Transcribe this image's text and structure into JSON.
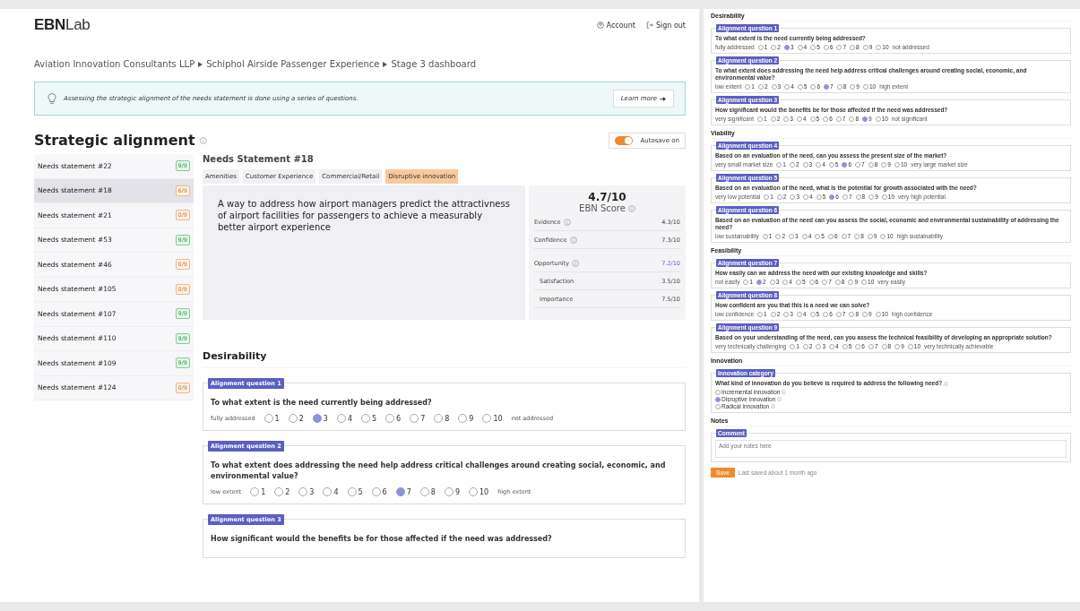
{
  "header": {
    "logo_bold": "EBN",
    "logo_light": "Lab",
    "links": [
      "Account",
      "Sign out"
    ]
  },
  "breadcrumb": [
    "Aviation Innovation Consultants LLP",
    "Schiphol Airside Passenger Experience",
    "Stage 3 dashboard"
  ],
  "banner": {
    "text": "Assessing the strategic alignment of the needs statement is done using a series of questions.",
    "link": "Learn more"
  },
  "page_title": "Strategic alignment",
  "autosave": {
    "label": "Autosave on",
    "on": true
  },
  "needs_list": [
    {
      "label": "Needs statement #22",
      "badge": "9/9",
      "complete": true,
      "selected": false
    },
    {
      "label": "Needs statement #18",
      "badge": "6/9",
      "complete": false,
      "selected": true
    },
    {
      "label": "Needs statement #21",
      "badge": "0/9",
      "complete": false,
      "selected": false
    },
    {
      "label": "Needs statement #53",
      "badge": "9/9",
      "complete": true,
      "selected": false
    },
    {
      "label": "Needs statement #46",
      "badge": "0/9",
      "complete": false,
      "selected": false
    },
    {
      "label": "Needs statement #105",
      "badge": "0/9",
      "complete": false,
      "selected": false
    },
    {
      "label": "Needs statement #107",
      "badge": "9/9",
      "complete": true,
      "selected": false
    },
    {
      "label": "Needs statement #110",
      "badge": "9/9",
      "complete": true,
      "selected": false
    },
    {
      "label": "Needs statement #109",
      "badge": "9/9",
      "complete": true,
      "selected": false
    },
    {
      "label": "Needs statement #124",
      "badge": "0/9",
      "complete": false,
      "selected": false
    }
  ],
  "statement": {
    "title": "Needs Statement #18",
    "tags": [
      {
        "label": "Amenities",
        "highlighted": false
      },
      {
        "label": "Customer Experience",
        "highlighted": false
      },
      {
        "label": "Commercial/Retail",
        "highlighted": false
      },
      {
        "label": "Disruptive innovation",
        "highlighted": true
      }
    ],
    "text": "A way to address how airport managers predict the attractivness of airport facilities for passengers to achieve a measurably better airport experience"
  },
  "score": {
    "value": "4.7/10",
    "label": "EBN Score",
    "rows": [
      {
        "kind": "metric",
        "label": "Evidence",
        "value": "4.3/10"
      },
      {
        "kind": "metric",
        "label": "Confidence",
        "value": "7.3/10"
      },
      {
        "kind": "highlight",
        "label": "Opportunity",
        "value": "7.2/10"
      },
      {
        "kind": "sub",
        "label": "Satisfaction",
        "value": "3.5/10"
      },
      {
        "kind": "sub",
        "label": "Importance",
        "value": "7.5/10"
      }
    ]
  },
  "main_form": {
    "sections": [
      {
        "title": "Desirability",
        "questions": [
          {
            "badge": "Alignment question 1",
            "text": "To what extent is the need currently being addressed?",
            "low": "fully addressed",
            "high": "not addressed",
            "options": [
              {
                "label": "1",
                "selected": false
              },
              {
                "label": "2",
                "selected": false
              },
              {
                "label": "3",
                "selected": true
              },
              {
                "label": "4",
                "selected": false
              },
              {
                "label": "5",
                "selected": false
              },
              {
                "label": "6",
                "selected": false
              },
              {
                "label": "7",
                "selected": false
              },
              {
                "label": "8",
                "selected": false
              },
              {
                "label": "9",
                "selected": false
              },
              {
                "label": "10",
                "selected": false
              }
            ]
          },
          {
            "badge": "Alignment question 2",
            "text": "To what extent does addressing the need help address critical challenges around creating social, economic, and environmental value?",
            "low": "low extent",
            "high": "high extent",
            "options": [
              {
                "label": "1",
                "selected": false
              },
              {
                "label": "2",
                "selected": false
              },
              {
                "label": "3",
                "selected": false
              },
              {
                "label": "4",
                "selected": false
              },
              {
                "label": "5",
                "selected": false
              },
              {
                "label": "6",
                "selected": false
              },
              {
                "label": "7",
                "selected": true
              },
              {
                "label": "8",
                "selected": false
              },
              {
                "label": "9",
                "selected": false
              },
              {
                "label": "10",
                "selected": false
              }
            ]
          },
          {
            "badge": "Alignment question 3",
            "text": "How significant would the benefits be for those affected if the need was addressed?"
          }
        ]
      }
    ]
  },
  "overview": {
    "sections": [
      {
        "title": "Desirability",
        "questions": [
          {
            "badge": "Alignment question 1",
            "text": "To what extent is the need currently being addressed?",
            "low": "fully addressed",
            "high": "not addressed",
            "options": [
              {
                "label": "1",
                "selected": false
              },
              {
                "label": "2",
                "selected": false
              },
              {
                "label": "3",
                "selected": true
              },
              {
                "label": "4",
                "selected": false
              },
              {
                "label": "5",
                "selected": false
              },
              {
                "label": "6",
                "selected": false
              },
              {
                "label": "7",
                "selected": false
              },
              {
                "label": "8",
                "selected": false
              },
              {
                "label": "9",
                "selected": false
              },
              {
                "label": "10",
                "selected": false
              }
            ]
          },
          {
            "badge": "Alignment question 2",
            "text": "To what extent does addressing the need help address critical challenges around creating social, economic, and environmental value?",
            "low": "low extent",
            "high": "high extent",
            "options": [
              {
                "label": "1",
                "selected": false
              },
              {
                "label": "2",
                "selected": false
              },
              {
                "label": "3",
                "selected": false
              },
              {
                "label": "4",
                "selected": false
              },
              {
                "label": "5",
                "selected": false
              },
              {
                "label": "6",
                "selected": false
              },
              {
                "label": "7",
                "selected": true
              },
              {
                "label": "8",
                "selected": false
              },
              {
                "label": "9",
                "selected": false
              },
              {
                "label": "10",
                "selected": false
              }
            ]
          },
          {
            "badge": "Alignment question 3",
            "text": "How significant would the benefits be for those affected if the need was addressed?",
            "low": "very significant",
            "high": "not significant",
            "options": [
              {
                "label": "1",
                "selected": false
              },
              {
                "label": "2",
                "selected": false
              },
              {
                "label": "3",
                "selected": false
              },
              {
                "label": "4",
                "selected": false
              },
              {
                "label": "5",
                "selected": false
              },
              {
                "label": "6",
                "selected": false
              },
              {
                "label": "7",
                "selected": false
              },
              {
                "label": "8",
                "selected": false
              },
              {
                "label": "9",
                "selected": true
              },
              {
                "label": "10",
                "selected": false
              }
            ]
          }
        ]
      },
      {
        "title": "Viability",
        "questions": [
          {
            "badge": "Alignment question 4",
            "text": "Based on an evaluation of the need, can you assess the present size of the market?",
            "low": "very small market size",
            "high": "very large market size",
            "options": [
              {
                "label": "1",
                "selected": false
              },
              {
                "label": "2",
                "selected": false
              },
              {
                "label": "3",
                "selected": false
              },
              {
                "label": "4",
                "selected": false
              },
              {
                "label": "5",
                "selected": false
              },
              {
                "label": "6",
                "selected": true
              },
              {
                "label": "7",
                "selected": false
              },
              {
                "label": "8",
                "selected": false
              },
              {
                "label": "9",
                "selected": false
              },
              {
                "label": "10",
                "selected": false
              }
            ]
          },
          {
            "badge": "Alignment question 5",
            "text": "Based on an evaluation of the need, what is the potential for growth associated with the need?",
            "low": "very low potential",
            "high": "very high potential",
            "options": [
              {
                "label": "1",
                "selected": false
              },
              {
                "label": "2",
                "selected": false
              },
              {
                "label": "3",
                "selected": false
              },
              {
                "label": "4",
                "selected": false
              },
              {
                "label": "5",
                "selected": false
              },
              {
                "label": "6",
                "selected": true
              },
              {
                "label": "7",
                "selected": false
              },
              {
                "label": "8",
                "selected": false
              },
              {
                "label": "9",
                "selected": false
              },
              {
                "label": "10",
                "selected": false
              }
            ]
          },
          {
            "badge": "Alignment question 6",
            "text": "Based on an evaluation of the need can you assess the social, economic and environmental sustainability of addressing the need?",
            "low": "low sustainability",
            "high": "high sustainability",
            "options": [
              {
                "label": "1",
                "selected": false
              },
              {
                "label": "2",
                "selected": false
              },
              {
                "label": "3",
                "selected": false
              },
              {
                "label": "4",
                "selected": false
              },
              {
                "label": "5",
                "selected": false
              },
              {
                "label": "6",
                "selected": false
              },
              {
                "label": "7",
                "selected": false
              },
              {
                "label": "8",
                "selected": false
              },
              {
                "label": "9",
                "selected": false
              },
              {
                "label": "10",
                "selected": false
              }
            ]
          }
        ]
      },
      {
        "title": "Feasibility",
        "questions": [
          {
            "badge": "Alignment question 7",
            "text": "How easily can we address the need with our existing knowledge and skills?",
            "low": "not easily",
            "high": "very easily",
            "options": [
              {
                "label": "1",
                "selected": false
              },
              {
                "label": "2",
                "selected": true
              },
              {
                "label": "3",
                "selected": false
              },
              {
                "label": "4",
                "selected": false
              },
              {
                "label": "5",
                "selected": false
              },
              {
                "label": "6",
                "selected": false
              },
              {
                "label": "7",
                "selected": false
              },
              {
                "label": "8",
                "selected": false
              },
              {
                "label": "9",
                "selected": false
              },
              {
                "label": "10",
                "selected": false
              }
            ]
          },
          {
            "badge": "Alignment question 8",
            "text": "How confident are you that this is a need we can solve?",
            "low": "low confidence",
            "high": "high confidence",
            "options": [
              {
                "label": "1",
                "selected": false
              },
              {
                "label": "2",
                "selected": false
              },
              {
                "label": "3",
                "selected": false
              },
              {
                "label": "4",
                "selected": false
              },
              {
                "label": "5",
                "selected": false
              },
              {
                "label": "6",
                "selected": false
              },
              {
                "label": "7",
                "selected": false
              },
              {
                "label": "8",
                "selected": false
              },
              {
                "label": "9",
                "selected": false
              },
              {
                "label": "10",
                "selected": false
              }
            ]
          },
          {
            "badge": "Alignment question 9",
            "text": "Based on your understanding of the need, can you assess the technical feasibility of developing an appropriate solution?",
            "low": "very technically challenging",
            "high": "very technically achievable",
            "options": [
              {
                "label": "1",
                "selected": false
              },
              {
                "label": "2",
                "selected": false
              },
              {
                "label": "3",
                "selected": false
              },
              {
                "label": "4",
                "selected": false
              },
              {
                "label": "5",
                "selected": false
              },
              {
                "label": "6",
                "selected": false
              },
              {
                "label": "7",
                "selected": false
              },
              {
                "label": "8",
                "selected": false
              },
              {
                "label": "9",
                "selected": false
              },
              {
                "label": "10",
                "selected": false
              }
            ]
          }
        ]
      }
    ],
    "innovation": {
      "title": "Innovation",
      "badge": "Innovation category",
      "text": "What kind of innovation do you believe is required to address the following need?",
      "options": [
        {
          "label": "Incremental innovation",
          "selected": false
        },
        {
          "label": "Disruptive innovation",
          "selected": true
        },
        {
          "label": "Radical innovation",
          "selected": false
        }
      ]
    },
    "notes": {
      "title": "Notes",
      "badge": "Comment",
      "placeholder": "Add your notes here"
    },
    "save": "Save",
    "last_saved": "Last saved about 1 month ago"
  }
}
